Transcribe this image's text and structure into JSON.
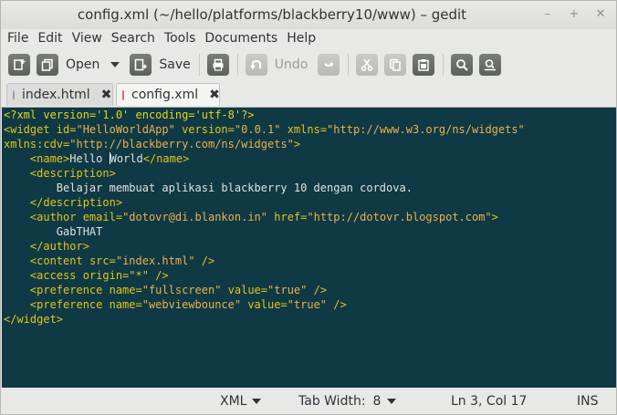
{
  "window": {
    "title": "config.xml (~/hello/platforms/blackberry10/www) – gedit",
    "controls": [
      "–",
      "+",
      "✕"
    ]
  },
  "menubar": {
    "items": [
      "File",
      "Edit",
      "View",
      "Search",
      "Tools",
      "Documents",
      "Help"
    ]
  },
  "toolbar": {
    "new_icon": "new-document-icon",
    "open_label": "Open",
    "save_label": "Save",
    "print_icon": "print-icon",
    "undo_label": "Undo",
    "redo_icon": "redo-icon",
    "cut_icon": "cut-icon",
    "copy_icon": "copy-icon",
    "paste_icon": "paste-icon",
    "find_icon": "find-icon",
    "replace_icon": "find-replace-icon"
  },
  "tabs": [
    {
      "label": "index.html",
      "close": "✖",
      "active": false
    },
    {
      "label": "config.xml",
      "close": "✖",
      "active": true
    }
  ],
  "editor": {
    "lines": [
      [
        {
          "t": "<?xml version='1.0' encoding='utf-8'?>",
          "c": "decl"
        }
      ],
      [
        {
          "t": "<widget ",
          "c": "tag"
        },
        {
          "t": "id=",
          "c": "attr"
        },
        {
          "t": "\"HelloWorldApp\"",
          "c": "val"
        },
        {
          "t": " version=",
          "c": "attr"
        },
        {
          "t": "\"0.0.1\"",
          "c": "val"
        },
        {
          "t": " xmlns=",
          "c": "attr"
        },
        {
          "t": "\"http://www.w3.org/ns/widgets\"",
          "c": "val"
        }
      ],
      [
        {
          "t": "xmlns:cdv=",
          "c": "attr"
        },
        {
          "t": "\"http://blackberry.com/ns/widgets\"",
          "c": "val"
        },
        {
          "t": ">",
          "c": "tag"
        }
      ],
      [
        {
          "t": "    ",
          "c": "text"
        },
        {
          "t": "<name>",
          "c": "tag"
        },
        {
          "t": "Hello ",
          "c": "text"
        },
        {
          "t": "CURSOR",
          "c": "cursor"
        },
        {
          "t": "World",
          "c": "text"
        },
        {
          "t": "</name>",
          "c": "tag"
        }
      ],
      [
        {
          "t": "    ",
          "c": "text"
        },
        {
          "t": "<description>",
          "c": "tag"
        }
      ],
      [
        {
          "t": "        Belajar membuat aplikasi blackberry 10 dengan cordova.",
          "c": "text"
        }
      ],
      [
        {
          "t": "    ",
          "c": "text"
        },
        {
          "t": "</description>",
          "c": "tag"
        }
      ],
      [
        {
          "t": "    ",
          "c": "text"
        },
        {
          "t": "<author ",
          "c": "tag"
        },
        {
          "t": "email=",
          "c": "attr"
        },
        {
          "t": "\"dotovr@di.blankon.in\"",
          "c": "val"
        },
        {
          "t": " href=",
          "c": "attr"
        },
        {
          "t": "\"http://dotovr.blogspot.com\"",
          "c": "val"
        },
        {
          "t": ">",
          "c": "tag"
        }
      ],
      [
        {
          "t": "        GabTHAT",
          "c": "text"
        }
      ],
      [
        {
          "t": "    ",
          "c": "text"
        },
        {
          "t": "</author>",
          "c": "tag"
        }
      ],
      [
        {
          "t": "    ",
          "c": "text"
        },
        {
          "t": "<content ",
          "c": "tag"
        },
        {
          "t": "src=",
          "c": "attr"
        },
        {
          "t": "\"index.html\"",
          "c": "val"
        },
        {
          "t": " />",
          "c": "tag"
        }
      ],
      [
        {
          "t": "    ",
          "c": "text"
        },
        {
          "t": "<access ",
          "c": "tag"
        },
        {
          "t": "origin=",
          "c": "attr"
        },
        {
          "t": "\"*\"",
          "c": "val"
        },
        {
          "t": " />",
          "c": "tag"
        }
      ],
      [
        {
          "t": "    ",
          "c": "text"
        },
        {
          "t": "<preference ",
          "c": "tag"
        },
        {
          "t": "name=",
          "c": "attr"
        },
        {
          "t": "\"fullscreen\"",
          "c": "val"
        },
        {
          "t": " value=",
          "c": "attr"
        },
        {
          "t": "\"true\"",
          "c": "val"
        },
        {
          "t": " />",
          "c": "tag"
        }
      ],
      [
        {
          "t": "    ",
          "c": "text"
        },
        {
          "t": "<preference ",
          "c": "tag"
        },
        {
          "t": "name=",
          "c": "attr"
        },
        {
          "t": "\"webviewbounce\"",
          "c": "val"
        },
        {
          "t": " value=",
          "c": "attr"
        },
        {
          "t": "\"true\"",
          "c": "val"
        },
        {
          "t": " />",
          "c": "tag"
        }
      ],
      [
        {
          "t": "</widget>",
          "c": "tag"
        }
      ]
    ]
  },
  "statusbar": {
    "language": "XML",
    "tab_width_label": "Tab Width:",
    "tab_width_value": "8",
    "position": "Ln 3, Col 17",
    "mode": "INS"
  },
  "colors": {
    "editor_bg": "#0f3944",
    "tag": "#e0c51a",
    "value": "#ecb14c",
    "text": "#dfe2e0"
  }
}
